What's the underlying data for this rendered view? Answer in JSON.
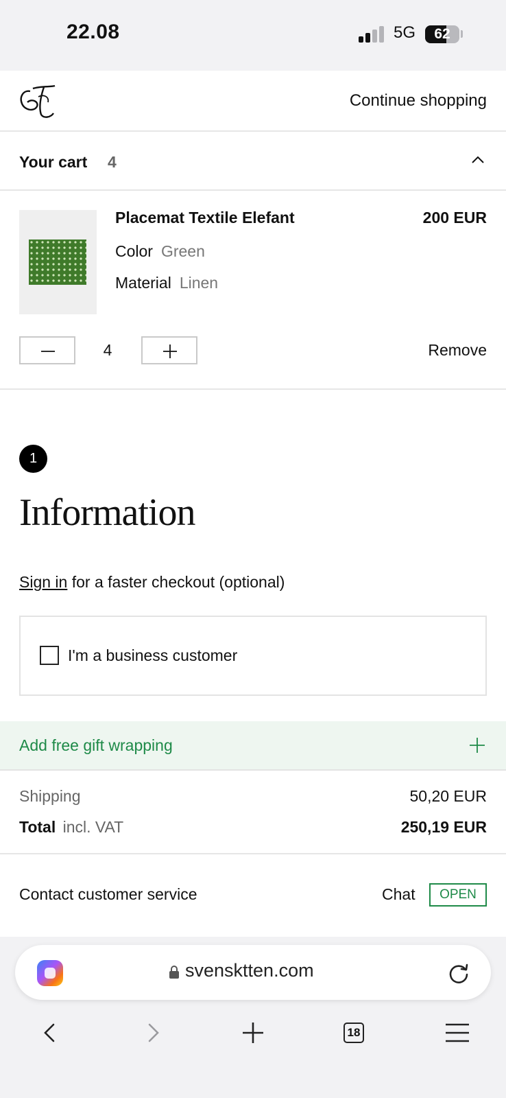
{
  "status_bar": {
    "time": "22.08",
    "network": "5G",
    "battery": "62",
    "battery_level": 0.62
  },
  "header": {
    "logo": "ST",
    "continue_label": "Continue shopping"
  },
  "cart": {
    "title": "Your cart",
    "count": "4",
    "item": {
      "name": "Placemat Textile Elefant",
      "price": "200 EUR",
      "attributes": [
        {
          "key": "Color",
          "value": "Green"
        },
        {
          "key": "Material",
          "value": "Linen"
        }
      ],
      "quantity": "4",
      "remove_label": "Remove"
    }
  },
  "information": {
    "step": "1",
    "title": "Information",
    "signin_link": "Sign in",
    "signin_suffix": " for a faster checkout (optional)",
    "business_label": "I'm a business customer"
  },
  "gift": {
    "label": "Add free gift wrapping"
  },
  "totals": {
    "shipping_label": "Shipping",
    "shipping_value": "50,20 EUR",
    "total_label": "Total",
    "total_note": "incl. VAT",
    "total_value": "250,19 EUR"
  },
  "contact": {
    "label": "Contact customer service",
    "chat_label": "Chat",
    "status": "OPEN"
  },
  "browser": {
    "url": "svensktten.com",
    "tabs": "18"
  },
  "colors": {
    "accent_green": "#1e8a48",
    "gift_bg": "#eef6f0"
  },
  "icons": [
    "chevron-up-icon",
    "minus-icon",
    "plus-icon",
    "lock-icon",
    "reload-icon",
    "back-icon",
    "forward-icon",
    "new-tab-icon",
    "tabs-icon",
    "menu-icon",
    "copilot-icon"
  ]
}
